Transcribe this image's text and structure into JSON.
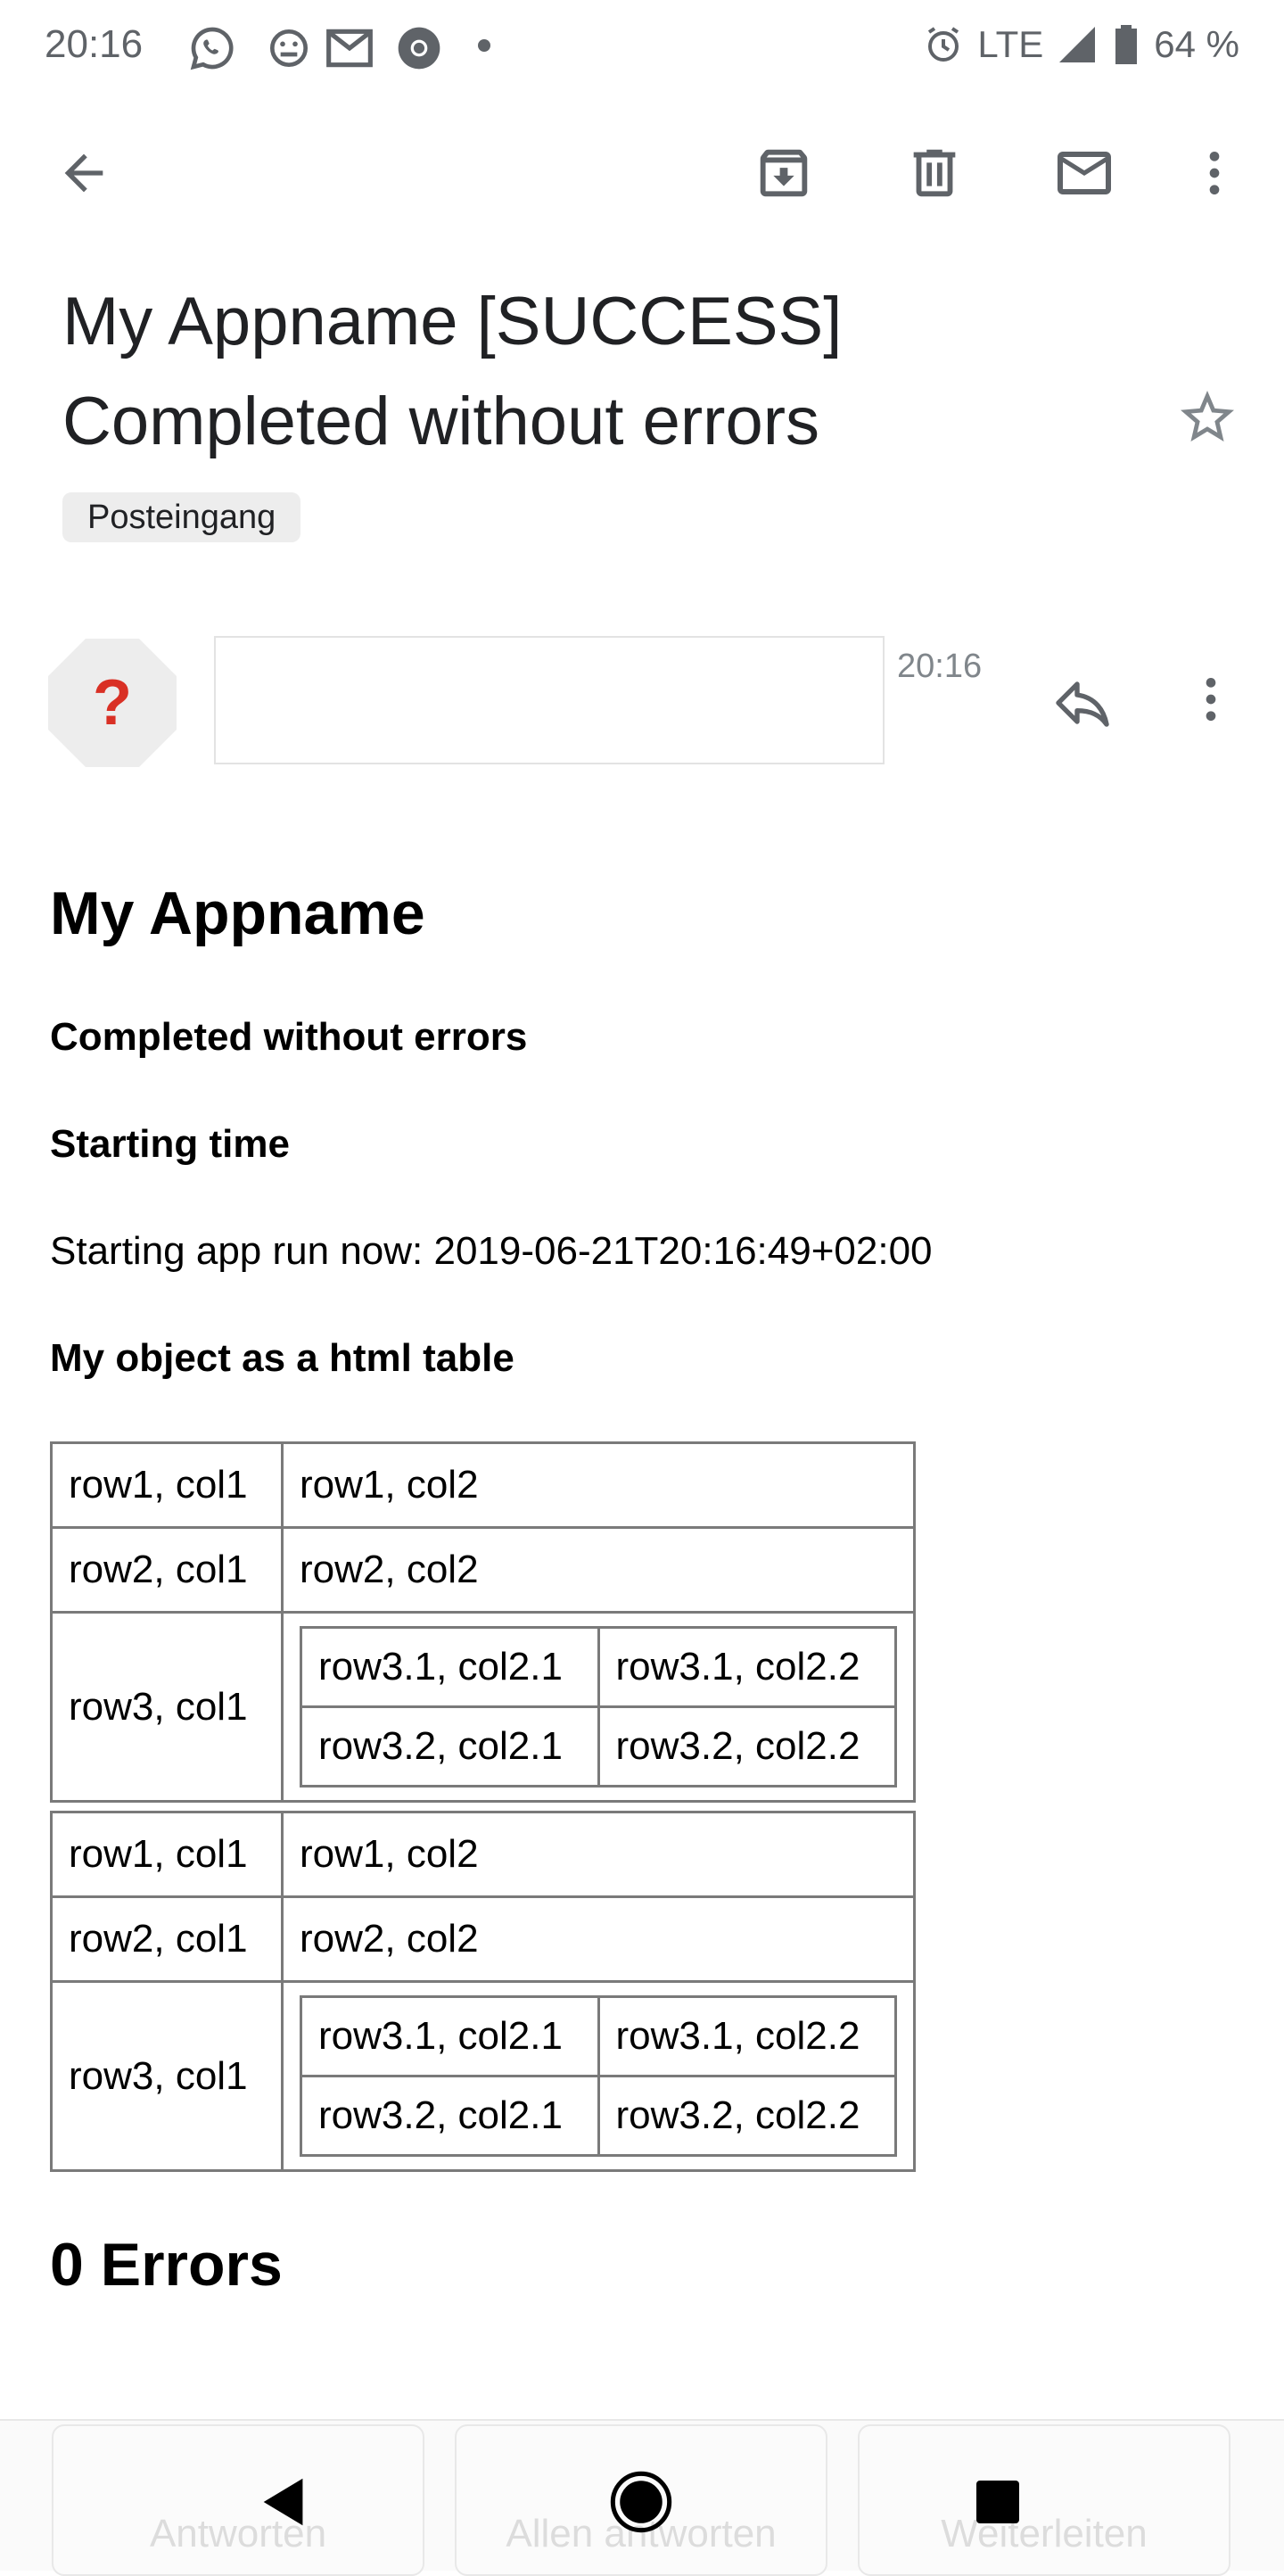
{
  "status_bar": {
    "time": "20:16",
    "network": "LTE",
    "battery": "64 %",
    "notification_icons": [
      "whatsapp-icon",
      "app-icon",
      "gmail-icon",
      "chrome-icon",
      "dot-icon"
    ]
  },
  "toolbar": {
    "icons": [
      "back-arrow-icon",
      "archive-icon",
      "delete-icon",
      "mark-unread-icon",
      "more-vert-icon"
    ]
  },
  "email": {
    "subject": "My Appname [SUCCESS] Completed without errors",
    "label": "Posteingang",
    "sender_avatar": "?",
    "time": "20:16"
  },
  "body": {
    "heading": "My Appname",
    "status": "Completed without errors",
    "section_start": "Starting time",
    "start_text": "Starting app run now: 2019-06-21T20:16:49+02:00",
    "section_table": "My object as a html table",
    "table_blocks": [
      {
        "r1": [
          "row1, col1",
          "row1, col2"
        ],
        "r2": [
          "row2, col1",
          "row2, col2"
        ],
        "r3_label": "row3, col1",
        "r3_nested": [
          [
            "row3.1, col2.1",
            "row3.1, col2.2"
          ],
          [
            "row3.2, col2.1",
            "row3.2, col2.2"
          ]
        ]
      },
      {
        "r1": [
          "row1, col1",
          "row1, col2"
        ],
        "r2": [
          "row2, col1",
          "row2, col2"
        ],
        "r3_label": "row3, col1",
        "r3_nested": [
          [
            "row3.1, col2.1",
            "row3.1, col2.2"
          ],
          [
            "row3.2, col2.1",
            "row3.2, col2.2"
          ]
        ]
      }
    ],
    "errors": "0 Errors"
  },
  "actions": {
    "reply": "Antworten",
    "reply_all": "Allen antworten",
    "forward": "Weiterleiten"
  },
  "colors": {
    "avatar_bg": "#ededed",
    "avatar_fg": "#d93025",
    "icon": "#5f6368"
  }
}
